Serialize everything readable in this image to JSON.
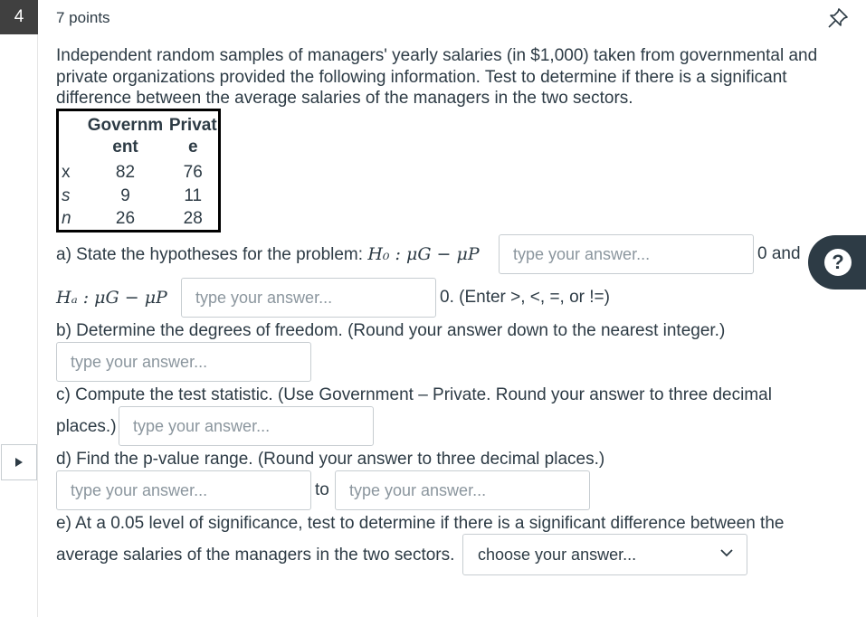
{
  "question": {
    "number": "4",
    "points": "7 points",
    "prompt": "Independent random samples of managers' yearly salaries (in $1,000) taken from governmental and private organizations provided the following information. Test to determine if there is a significant difference between the average salaries of the managers in the two sectors."
  },
  "table": {
    "headers": [
      "Governm ent",
      "Privat e"
    ],
    "rows": [
      {
        "label": "x",
        "government": "82",
        "private": "76"
      },
      {
        "label": "s",
        "government": "9",
        "private": "11"
      },
      {
        "label": "n",
        "government": "26",
        "private": "28"
      }
    ]
  },
  "part_a": {
    "text": "a) State the hypotheses for the problem:",
    "h0_math": "H₀ : μG − μP",
    "after_h0": "0 and",
    "ha_math": "Hₐ : μG − μP",
    "after_ha": "0. (Enter >, <, =, or !=)"
  },
  "part_b": {
    "text": "b) Determine the degrees of freedom. (Round your answer down to the nearest integer.)"
  },
  "part_c": {
    "text1": "c) Compute the test statistic. (Use Government – Private. Round your answer to three decimal",
    "text2": "places.)"
  },
  "part_d": {
    "text": "d) Find the p-value range. (Round your answer to three decimal places.)",
    "to": "to"
  },
  "part_e": {
    "text1": "e) At a 0.05 level of significance, test to determine if there is a significant difference between the",
    "text2": "average salaries of the managers in the two sectors."
  },
  "inputs": {
    "placeholder": "type your answer..."
  },
  "select": {
    "label": "choose your answer..."
  },
  "help": {
    "label": "?"
  },
  "icons": {
    "pin": "pin-icon",
    "flag": "flag-arrow-icon",
    "chevron": "chevron-down-icon",
    "help": "question-mark-icon"
  }
}
